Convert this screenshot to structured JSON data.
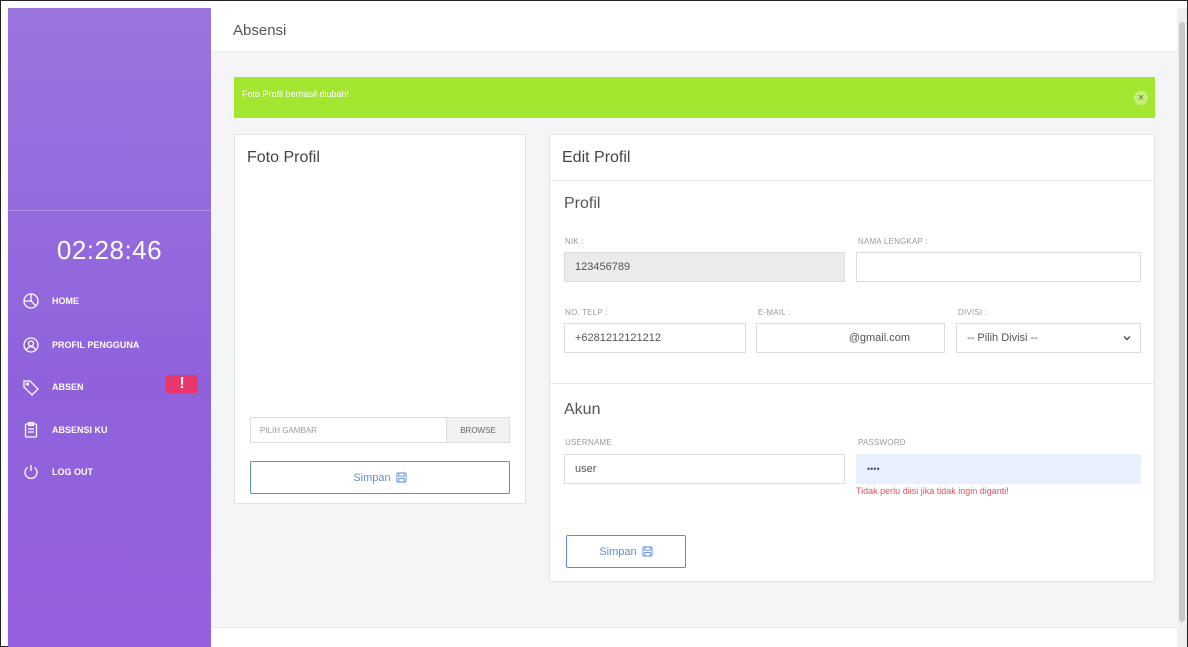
{
  "sidebar": {
    "clock": "02:28:46",
    "items": [
      {
        "label": "HOME",
        "icon": "pie-chart-icon"
      },
      {
        "label": "PROFIL PENGGUNA",
        "icon": "user-circle-icon"
      },
      {
        "label": "ABSEN",
        "icon": "tag-icon",
        "badge": "!"
      },
      {
        "label": "ABSENSI KU",
        "icon": "clipboard-icon"
      },
      {
        "label": "LOG OUT",
        "icon": "power-icon"
      }
    ]
  },
  "header": {
    "title": "Absensi"
  },
  "alert": {
    "message": "Foto Profil berhasil diubah!",
    "close": "×",
    "color": "#a3e62f"
  },
  "foto_profil": {
    "title": "Foto Profil",
    "file_placeholder": "PILIH GAMBAR",
    "browse_label": "BROWSE",
    "save_label": "Simpan"
  },
  "edit_profil": {
    "title": "Edit Profil",
    "profil_section": "Profil",
    "nik_label": "NIK :",
    "nik_value": "123456789",
    "nama_label": "NAMA LENGKAP :",
    "nama_value": "",
    "telp_label": "NO. TELP :",
    "telp_value": "+6281212121212",
    "email_label": "E-MAIL :",
    "email_value": "@gmail.com",
    "divisi_label": "DIVISI :",
    "divisi_value": "-- Pilih Divisi --",
    "akun_section": "Akun",
    "username_label": "USERNAME",
    "username_value": "user",
    "password_label": "PASSWORD",
    "password_value": "••••",
    "password_hint": "Tidak perlu diisi jika tidak ingin diganti!",
    "save_label": "Simpan"
  },
  "colors": {
    "sidebar": "#9067dc",
    "accent": "#5b8dd6",
    "danger": "#e74c5b",
    "badge": "#e9366b"
  }
}
